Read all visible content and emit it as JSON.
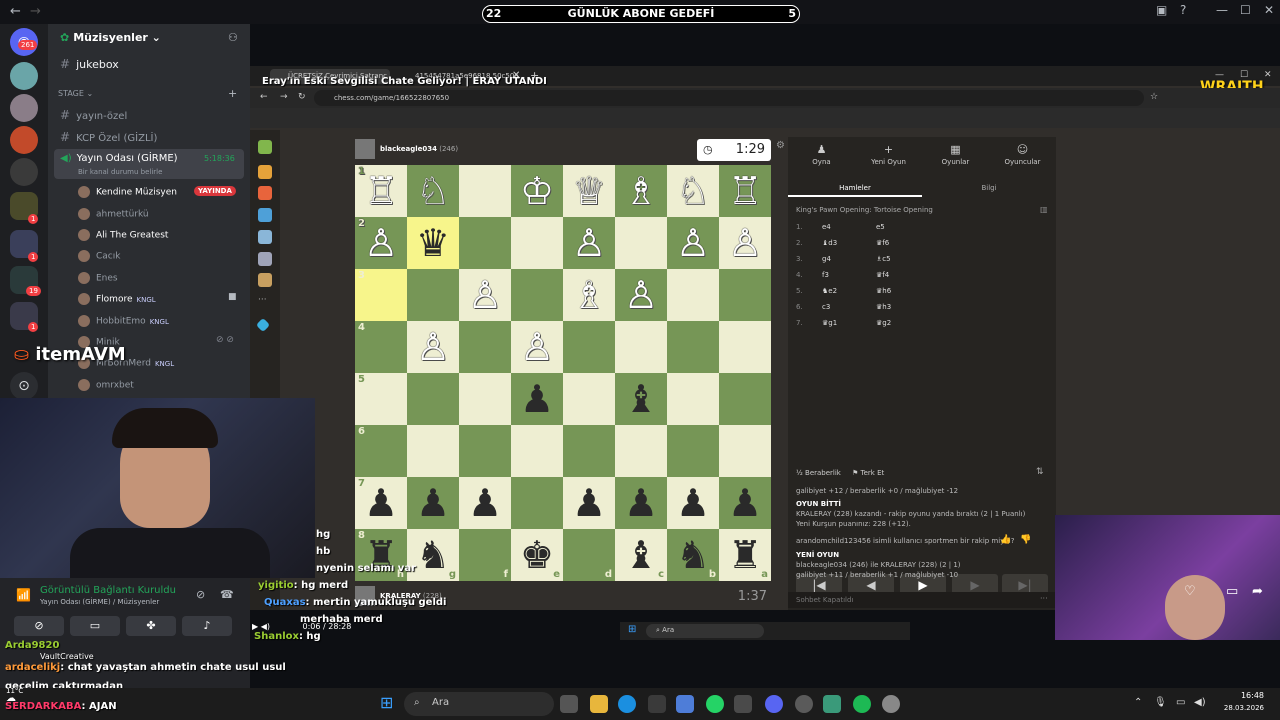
{
  "topbar": {
    "back": "←",
    "forward": "→",
    "goal_left": "22",
    "goal_title": "GÜNLÜK ABONE GEDEFİ",
    "goal_right": "5"
  },
  "rail": {
    "badges": [
      "261",
      "1",
      "1",
      "19",
      "1"
    ]
  },
  "server": {
    "name": "Müzisyenler",
    "jukebox": "jukebox",
    "stage_label": "STAGE",
    "channels": [
      "yayın-özel",
      "KCP Özel (GİZLİ)"
    ],
    "voice_channel": "Yayın Odası (GİRME)",
    "voice_time": "5:18:36",
    "voice_status": "Bir kanal durumu belirle",
    "users": [
      {
        "name": "Kendine Müzisyen",
        "tag": "YAYINDA"
      },
      {
        "name": "ahmettürkü",
        "tag": ""
      },
      {
        "name": "Ali The Greatest",
        "tag": ""
      },
      {
        "name": "Cacık",
        "tag": ""
      },
      {
        "name": "Enes",
        "tag": ""
      },
      {
        "name": "Flomore",
        "tag": "KNGL"
      },
      {
        "name": "HobbitEmo",
        "tag": "KNGL"
      },
      {
        "name": "Minik",
        "tag": ""
      },
      {
        "name": "MrBornMerd",
        "tag": "KNGL"
      },
      {
        "name": "omrxbet",
        "tag": ""
      }
    ]
  },
  "overlay": {
    "itemavm": "itemAVM",
    "wraith": "WRAITH",
    "stream_title": "Eray'ın Eski Sevgilisi Chate Geliyor! | ERAY UTANDI"
  },
  "browser": {
    "tab1": "ÜCRETSİZ Çevrimiçi Satranç",
    "tab2": "415454781a5e96818.50c50a...",
    "url": "chess.com/game/166522807650"
  },
  "game": {
    "top_player": "blackeagle034",
    "top_rating": "(246)",
    "top_clock": "1:29",
    "bottom_player": "KRALERAY",
    "bottom_rating": "(228)",
    "bottom_clock": "1:37",
    "rank_labels": [
      "1",
      "2",
      "3",
      "4",
      "5",
      "6",
      "7",
      "8"
    ],
    "file_labels": [
      "h",
      "g",
      "f",
      "e",
      "d",
      "c",
      "b",
      "a"
    ],
    "board": [
      [
        "♖",
        "♘",
        "",
        "♔",
        "♕",
        "♗",
        "♘",
        "♖"
      ],
      [
        "♙",
        "♛",
        "",
        "",
        "♙",
        "",
        "♙",
        "♙"
      ],
      [
        "",
        "",
        "♙",
        "",
        "♗",
        "♙",
        "",
        ""
      ],
      [
        "",
        "♙",
        "",
        "♙",
        "",
        "",
        "",
        ""
      ],
      [
        "",
        "",
        "",
        "♟",
        "",
        "♝",
        "",
        ""
      ],
      [
        "",
        "",
        "",
        "",
        "",
        "",
        "",
        ""
      ],
      [
        "♟",
        "♟",
        "♟",
        "",
        "♟",
        "♟",
        "♟",
        "♟"
      ],
      [
        "♜",
        "♞",
        "",
        "♚",
        "",
        "♝",
        "♞",
        "♜"
      ]
    ]
  },
  "panel": {
    "tabs": [
      {
        "label": "Oyna",
        "icon": "♟"
      },
      {
        "label": "Yeni Oyun",
        "icon": "+"
      },
      {
        "label": "Oyunlar",
        "icon": "▦"
      },
      {
        "label": "Oyuncular",
        "icon": "☺"
      }
    ],
    "subtabs": [
      "Hamleler",
      "Bilgi"
    ],
    "opening": "King's Pawn Opening: Tortoise Opening",
    "moves": [
      {
        "n": "1.",
        "w": "e4",
        "b": "e5"
      },
      {
        "n": "2.",
        "w": "♝d3",
        "b": "♛f6"
      },
      {
        "n": "3.",
        "w": "g4",
        "b": "♗c5"
      },
      {
        "n": "4.",
        "w": "f3",
        "b": "♛f4"
      },
      {
        "n": "5.",
        "w": "♞e2",
        "b": "♛h6"
      },
      {
        "n": "6.",
        "w": "c3",
        "b": "♛h3"
      },
      {
        "n": "7.",
        "w": "♛g1",
        "b": "♛g2"
      }
    ],
    "draw": "Beraberlik",
    "resign": "Terk Et",
    "log": [
      "galibiyet +12 / beraberlik +0 / mağlubiyet -12",
      "OYUN BİTTİ",
      "KRALERAY (228) kazandı - rakip oyunu yanda bıraktı (2 | 1 Puanlı)",
      "Yeni Kurşun puanınız: 228 (+12).",
      "arandomchild123456 isimli kullanıcı sportmen bir rakip miydi?",
      "YENİ OYUN",
      "blackeagle034 (246) ile KRALERAY (228) (2 | 1)",
      "galibiyet +11 / beraberlik +1 / mağlubiyet -10"
    ],
    "chat_placeholder": "Sohbet Kapatıldı"
  },
  "chat": [
    {
      "user": "",
      "msg": "hg"
    },
    {
      "user": "",
      "msg": "hb"
    },
    {
      "user": "",
      "msg": "nyenin selamı var"
    },
    {
      "user": "yigitio",
      "msg": ": hg merd"
    },
    {
      "user": "Quaxas",
      "msg": ": mertin yamukluşu geldi"
    },
    {
      "user": "Arda9820",
      "msg": ""
    },
    {
      "user": "ardacelikj",
      "msg": ": chat yavaştan ahmetin chate usul usul"
    },
    {
      "user": "",
      "msg": "geçelim çaktırmadan"
    },
    {
      "user": "SERDARKABA",
      "msg": ": AJAN"
    },
    {
      "user": "Shanlox",
      "msg": ": hg"
    },
    {
      "user": "",
      "msg": "merhaba merd"
    }
  ],
  "voice": {
    "connected": "Görüntülü Bağlantı Kuruldu",
    "sub": "Yayın Odası (GİRME) / Müzisyenler",
    "vault": "VaultCreative",
    "video_time": "0:06 / 28:28"
  },
  "taskbar": {
    "search": "Ara",
    "inner_search": "Ara",
    "time": "16:48",
    "date": "28.03.2026",
    "weather": "11°C"
  }
}
